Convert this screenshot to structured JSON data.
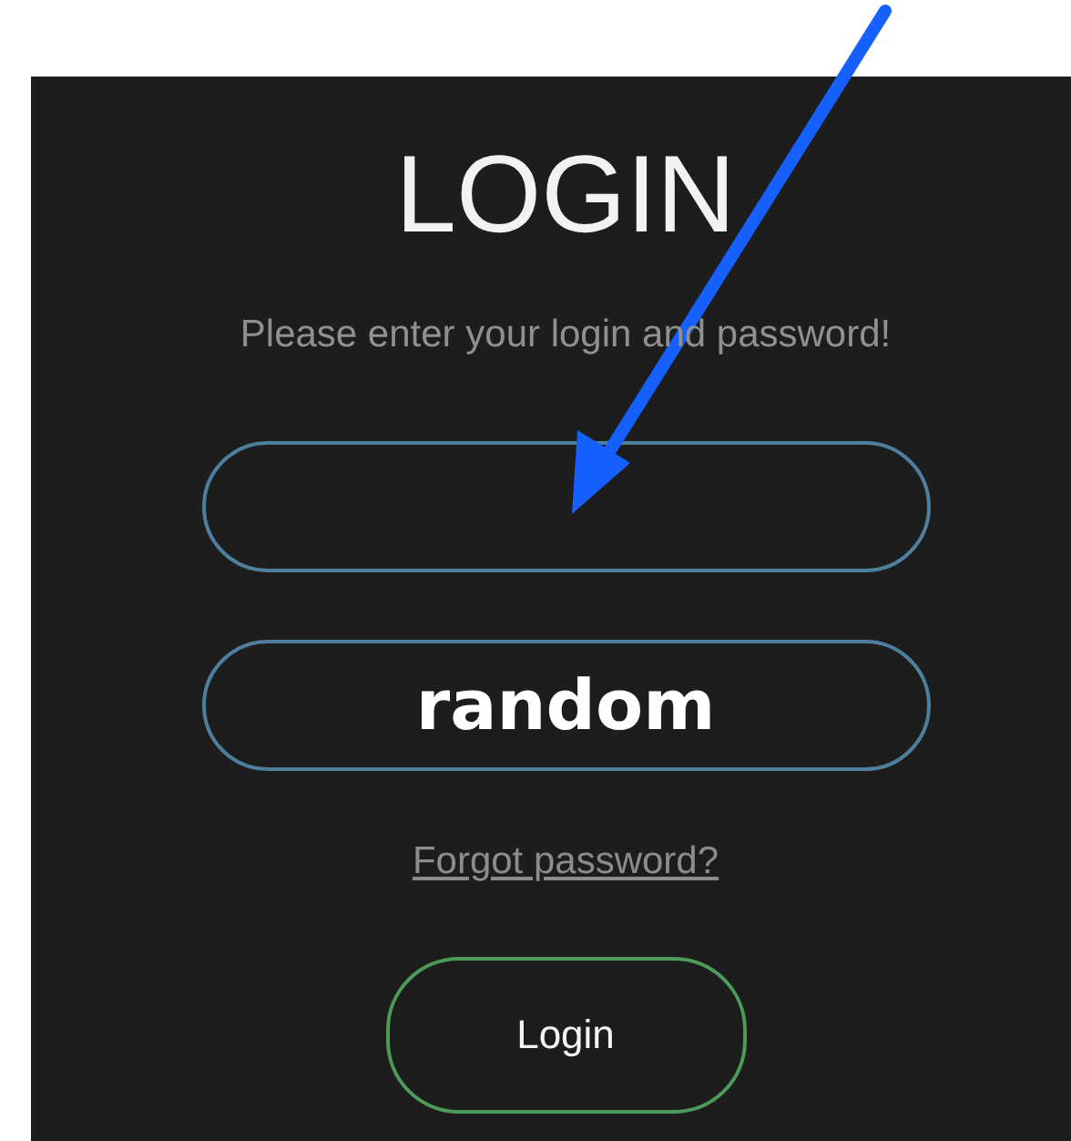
{
  "title": "LOGIN",
  "subtitle": "Please enter your login and password!",
  "password_field": {
    "value": "random"
  },
  "forgot_link": "Forgot password?",
  "login_button": "Login"
}
